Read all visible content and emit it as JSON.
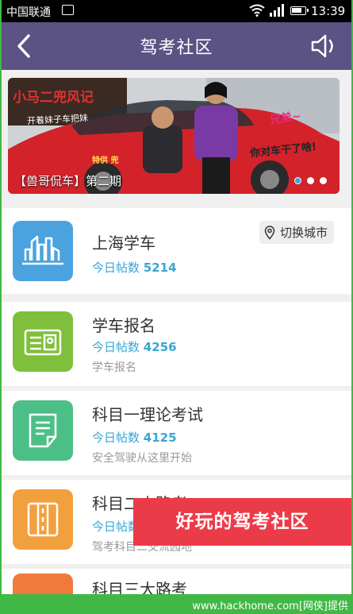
{
  "status_bar": {
    "carrier": "中国联通",
    "time": "13:39"
  },
  "header": {
    "title": "驾考社区"
  },
  "banner": {
    "caption": "【兽哥侃车】第二期",
    "script_text": "小马二兜风记",
    "script_subtext": "开着妹子车把妹",
    "tag_pink": "兄弟~",
    "tag_black": "你对车干了啥!",
    "tag_yellow": "特供 兜",
    "slide_count": 3,
    "active_slide": 1
  },
  "city": {
    "name": "上海学车",
    "count_label": "今日帖数",
    "count": "5214",
    "switch_label": "切换城市"
  },
  "forums": [
    {
      "title": "学车报名",
      "count_label": "今日帖数",
      "count": "4256",
      "subtitle": "学车报名"
    },
    {
      "title": "科目一理论考试",
      "count_label": "今日帖数",
      "count": "4125",
      "subtitle": "安全驾驶从这里开始"
    },
    {
      "title": "科目二小路考",
      "count_label": "今日帖数",
      "count": "",
      "subtitle": "驾考科目二交流园地"
    },
    {
      "title": "科目三大路考",
      "count_label": "",
      "count": "",
      "subtitle": ""
    }
  ],
  "promo": {
    "text": "好玩的驾考社区"
  },
  "watermark": "www.hackhome.com[网侠]提供",
  "colors": {
    "nav_bar": "#5a5384",
    "city_icon": "#4aa3df",
    "signup_icon": "#7fbf3b",
    "theory_icon": "#4cbf86",
    "road_icon": "#f2a03d",
    "road3_icon": "#f07a3c",
    "accent_blue": "#3aa6d6",
    "promo_red": "#ec3b48",
    "frame_green": "#41b846"
  }
}
